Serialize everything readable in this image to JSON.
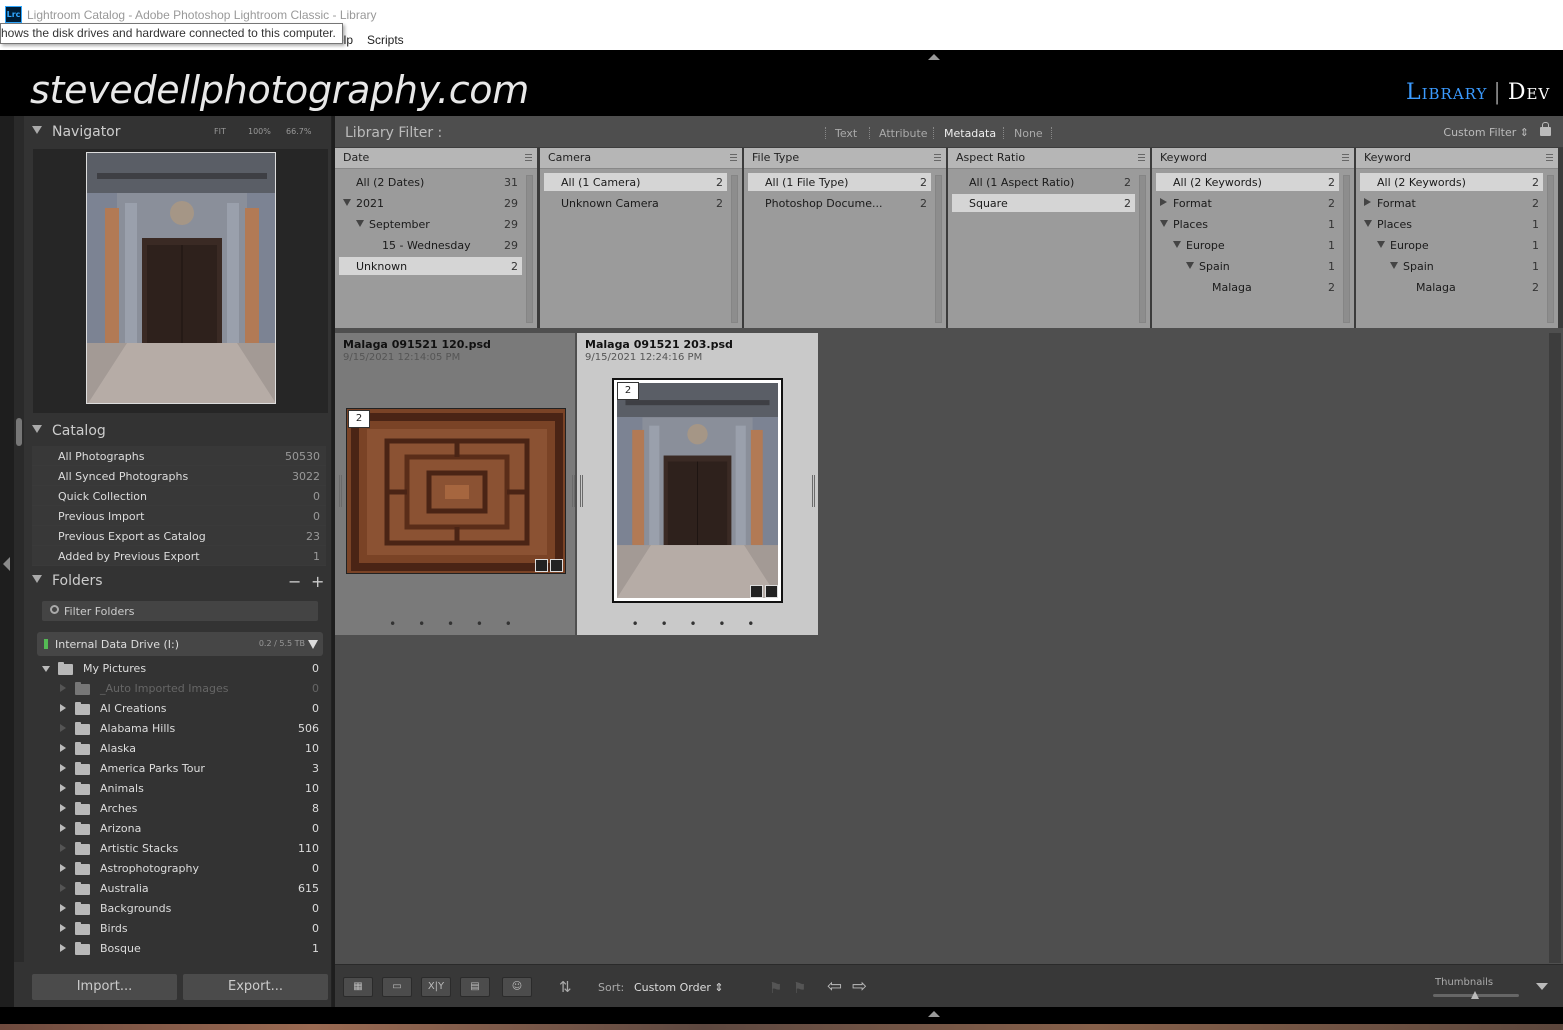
{
  "window": {
    "title": "Lightroom Catalog - Adobe Photoshop Lightroom Classic - Library",
    "app_icon": "Lrc",
    "menu_visible": [
      "elp",
      "Scripts"
    ],
    "tooltip": "hows the disk drives and hardware connected to this computer."
  },
  "identity_plate": "stevedellphotography.com",
  "modules": {
    "active": "Library",
    "separator": "|",
    "next": "Dev"
  },
  "navigator": {
    "title": "Navigator",
    "zoom": [
      "FIT",
      "100%",
      "66.7%"
    ]
  },
  "catalog": {
    "title": "Catalog",
    "items": [
      {
        "label": "All Photographs",
        "count": "50530"
      },
      {
        "label": "All Synced Photographs",
        "count": "3022"
      },
      {
        "label": "Quick Collection",
        "count": "0"
      },
      {
        "label": "Previous Import",
        "count": "0"
      },
      {
        "label": "Previous Export as Catalog",
        "count": "23"
      },
      {
        "label": "Added by Previous Export",
        "count": "1"
      }
    ]
  },
  "folders": {
    "title": "Folders",
    "minus": "−",
    "plus": "+",
    "filter_placeholder": "Filter Folders",
    "drive": {
      "label": "Internal Data Drive (I:)",
      "size": "0.2 / 5.5 TB"
    },
    "items": [
      {
        "label": "My Pictures",
        "count": "0",
        "level": 0,
        "expander": "open",
        "dim": false
      },
      {
        "label": "_Auto Imported Images",
        "count": "0",
        "level": 1,
        "expander": "none",
        "dim": true
      },
      {
        "label": "AI Creations",
        "count": "0",
        "level": 1,
        "expander": "closed",
        "dim": false
      },
      {
        "label": "Alabama Hills",
        "count": "506",
        "level": 1,
        "expander": "none",
        "dim": false
      },
      {
        "label": "Alaska",
        "count": "10",
        "level": 1,
        "expander": "closed",
        "dim": false
      },
      {
        "label": "America Parks Tour",
        "count": "3",
        "level": 1,
        "expander": "closed",
        "dim": false
      },
      {
        "label": "Animals",
        "count": "10",
        "level": 1,
        "expander": "closed",
        "dim": false
      },
      {
        "label": "Arches",
        "count": "8",
        "level": 1,
        "expander": "closed",
        "dim": false
      },
      {
        "label": "Arizona",
        "count": "0",
        "level": 1,
        "expander": "closed",
        "dim": false
      },
      {
        "label": "Artistic Stacks",
        "count": "110",
        "level": 1,
        "expander": "none",
        "dim": false
      },
      {
        "label": "Astrophotography",
        "count": "0",
        "level": 1,
        "expander": "closed",
        "dim": false
      },
      {
        "label": "Australia",
        "count": "615",
        "level": 1,
        "expander": "none",
        "dim": false
      },
      {
        "label": "Backgrounds",
        "count": "0",
        "level": 1,
        "expander": "closed",
        "dim": false
      },
      {
        "label": "Birds",
        "count": "0",
        "level": 1,
        "expander": "closed",
        "dim": false
      },
      {
        "label": "Bosque",
        "count": "1",
        "level": 1,
        "expander": "closed",
        "dim": false
      }
    ]
  },
  "left_buttons": {
    "import": "Import...",
    "export": "Export..."
  },
  "library_filter": {
    "title": "Library Filter :",
    "tabs": [
      "Text",
      "Attribute",
      "Metadata",
      "None"
    ],
    "active_tab": "Metadata",
    "preset": "Custom Filter"
  },
  "metadata_columns": [
    {
      "header": "Date",
      "rows": [
        {
          "label": "All (2 Dates)",
          "count": "31",
          "indent": 0,
          "tri": "",
          "sel": false
        },
        {
          "label": "2021",
          "count": "29",
          "indent": 0,
          "tri": "down",
          "sel": false
        },
        {
          "label": "September",
          "count": "29",
          "indent": 1,
          "tri": "down",
          "sel": false
        },
        {
          "label": "15 - Wednesday",
          "count": "29",
          "indent": 2,
          "tri": "",
          "sel": false
        },
        {
          "label": "Unknown",
          "count": "2",
          "indent": 0,
          "tri": "",
          "sel": true
        }
      ]
    },
    {
      "header": "Camera",
      "rows": [
        {
          "label": "All (1 Camera)",
          "count": "2",
          "indent": 0,
          "tri": "",
          "sel": true
        },
        {
          "label": "Unknown Camera",
          "count": "2",
          "indent": 0,
          "tri": "",
          "sel": false
        }
      ]
    },
    {
      "header": "File Type",
      "rows": [
        {
          "label": "All (1 File Type)",
          "count": "2",
          "indent": 0,
          "tri": "",
          "sel": true
        },
        {
          "label": "Photoshop Docume...",
          "count": "2",
          "indent": 0,
          "tri": "",
          "sel": false
        }
      ]
    },
    {
      "header": "Aspect Ratio",
      "rows": [
        {
          "label": "All (1 Aspect Ratio)",
          "count": "2",
          "indent": 0,
          "tri": "",
          "sel": false
        },
        {
          "label": "Square",
          "count": "2",
          "indent": 0,
          "tri": "",
          "sel": true
        }
      ]
    },
    {
      "header": "Keyword",
      "rows": [
        {
          "label": "All (2 Keywords)",
          "count": "2",
          "indent": 0,
          "tri": "",
          "sel": true
        },
        {
          "label": "Format",
          "count": "2",
          "indent": 0,
          "tri": "right",
          "sel": false
        },
        {
          "label": "Places",
          "count": "1",
          "indent": 0,
          "tri": "down",
          "sel": false
        },
        {
          "label": "Europe",
          "count": "1",
          "indent": 1,
          "tri": "down",
          "sel": false
        },
        {
          "label": "Spain",
          "count": "1",
          "indent": 2,
          "tri": "down",
          "sel": false
        },
        {
          "label": "Malaga",
          "count": "2",
          "indent": 3,
          "tri": "",
          "sel": false
        }
      ]
    },
    {
      "header": "Keyword",
      "rows": [
        {
          "label": "All (2 Keywords)",
          "count": "2",
          "indent": 0,
          "tri": "",
          "sel": true
        },
        {
          "label": "Format",
          "count": "2",
          "indent": 0,
          "tri": "right",
          "sel": false
        },
        {
          "label": "Places",
          "count": "1",
          "indent": 0,
          "tri": "down",
          "sel": false
        },
        {
          "label": "Europe",
          "count": "1",
          "indent": 1,
          "tri": "down",
          "sel": false
        },
        {
          "label": "Spain",
          "count": "1",
          "indent": 2,
          "tri": "down",
          "sel": false
        },
        {
          "label": "Malaga",
          "count": "2",
          "indent": 3,
          "tri": "",
          "sel": false
        }
      ]
    }
  ],
  "grid_photos": [
    {
      "filename": "Malaga 091521 120.psd",
      "datetime": "9/15/2021 12:14:05 PM",
      "stack_count": "2",
      "selected": false,
      "dots": "• • • • •"
    },
    {
      "filename": "Malaga 091521 203.psd",
      "datetime": "9/15/2021 12:24:16 PM",
      "stack_count": "2",
      "selected": true,
      "dots": "• • • • •"
    }
  ],
  "toolbar": {
    "view_buttons": [
      "grid-view-icon",
      "loupe-view-icon",
      "compare-view-icon",
      "survey-view-icon",
      "people-view-icon"
    ],
    "compare_label": "X|Y",
    "sort_label": "Sort:",
    "sort_value": "Custom Order",
    "thumbnails_label": "Thumbnails"
  },
  "colors": {
    "accent": "#3b9bff",
    "panel": "#333333",
    "grid_bg": "#4f4f4f",
    "filter_col": "#9b9b9b",
    "selected_cell": "#c9c9c9",
    "normal_cell": "#7a7a7a"
  }
}
